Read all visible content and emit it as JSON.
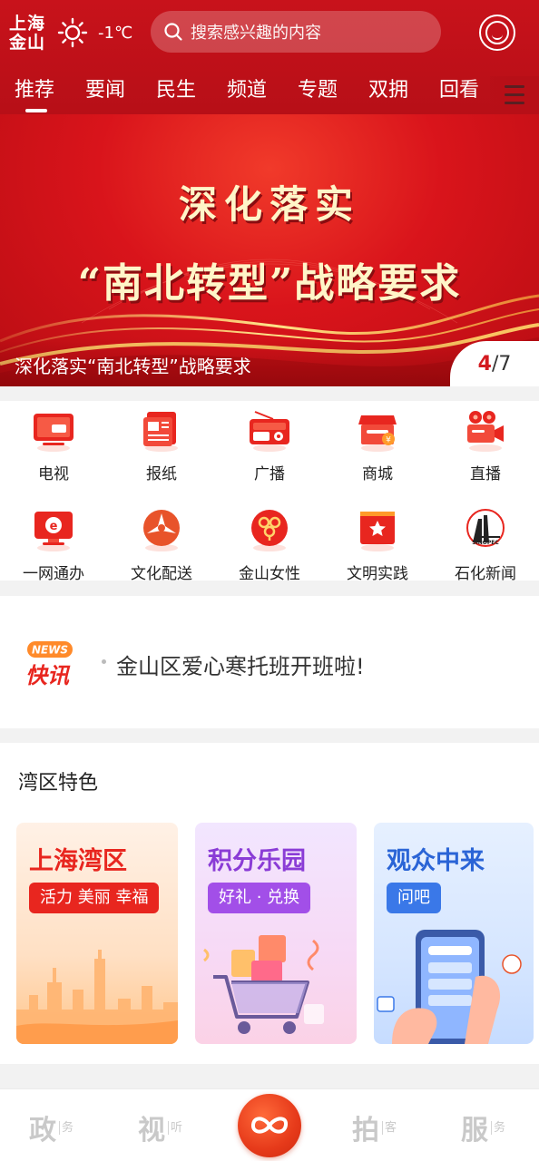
{
  "header": {
    "logo_line1": "上海",
    "logo_line2": "金山",
    "temperature": "-1℃",
    "weather_icon": "sun-icon",
    "search_placeholder": "搜索感兴趣的内容"
  },
  "tabs": [
    {
      "label": "推荐",
      "active": true
    },
    {
      "label": "要闻"
    },
    {
      "label": "民生"
    },
    {
      "label": "频道"
    },
    {
      "label": "专题"
    },
    {
      "label": "双拥"
    },
    {
      "label": "回看"
    }
  ],
  "banner": {
    "line1": "深化落实",
    "line2": "“南北转型”战略要求",
    "caption": "深化落实“南北转型”战略要求",
    "page_current": "4",
    "page_total": "/7"
  },
  "services": [
    {
      "label": "电视",
      "icon": "tv-icon"
    },
    {
      "label": "报纸",
      "icon": "newspaper-icon"
    },
    {
      "label": "广播",
      "icon": "radio-icon"
    },
    {
      "label": "商城",
      "icon": "shop-icon"
    },
    {
      "label": "直播",
      "icon": "live-camera-icon"
    },
    {
      "label": "一网通办",
      "icon": "e-service-icon"
    },
    {
      "label": "文化配送",
      "icon": "culture-delivery-icon"
    },
    {
      "label": "金山女性",
      "icon": "women-federation-icon"
    },
    {
      "label": "文明实践",
      "icon": "civilization-star-icon"
    },
    {
      "label": "石化新闻",
      "icon": "sinopec-icon"
    }
  ],
  "flash": {
    "badge_top": "NEWS",
    "badge_main": "快讯",
    "text": "金山区爱心寒托班开班啦!"
  },
  "bay": {
    "title": "湾区特色",
    "cards": [
      {
        "title": "上海湾区",
        "tag": "活力 美丽 幸福"
      },
      {
        "title": "积分乐园",
        "tag": "好礼 · 兑换"
      },
      {
        "title": "观众中来",
        "tag": "问吧"
      }
    ]
  },
  "bottom_nav": [
    {
      "big": "政",
      "small": "务"
    },
    {
      "big": "视",
      "small": "听"
    },
    {
      "big": "拍",
      "small": "客"
    },
    {
      "big": "服",
      "small": "务"
    }
  ],
  "colors": {
    "brand_red": "#c8121b",
    "accent_orange": "#e63a1a"
  }
}
